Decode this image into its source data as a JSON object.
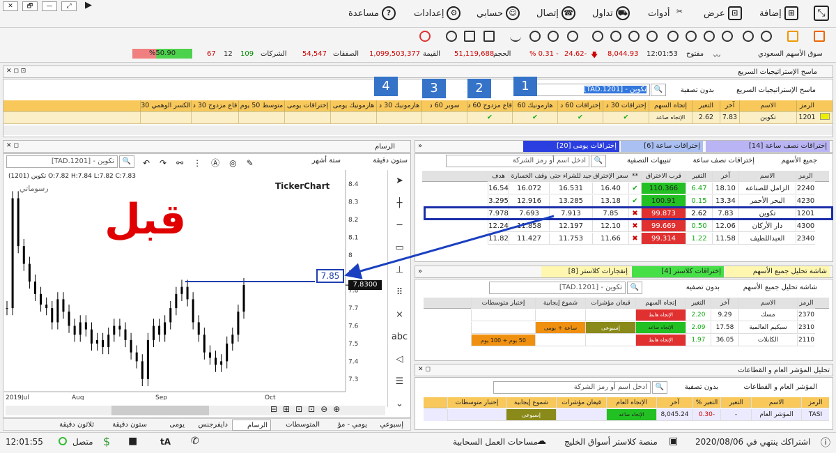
{
  "window": {
    "controls": [
      "✕",
      "🗗",
      "—",
      "⤢",
      "▶"
    ]
  },
  "menu": [
    {
      "label": "مساعدة",
      "icon": "?"
    },
    {
      "label": "إعدادات",
      "icon": "⚙"
    },
    {
      "label": "حسابي",
      "icon": "☺"
    },
    {
      "label": "إتصال",
      "icon": "☎"
    },
    {
      "label": "تداول",
      "icon": "⛟"
    },
    {
      "label": "أدوات",
      "icon": "✂"
    },
    {
      "label": "عرض",
      "icon": "⊡"
    },
    {
      "label": "إضافة",
      "icon": "⊞"
    }
  ],
  "ticker": {
    "market": "سوق الأسهم السعودي",
    "status": "مفتوح",
    "time": "12:01:53",
    "index": "8,044.93",
    "change": "24.62-",
    "change_pct": "% 0.31 -",
    "volume_label": "الحجم",
    "volume": "51,119,688",
    "value_label": "القيمة",
    "value": "1,099,503,377",
    "deals_label": "الصفقات",
    "deals": "54,547",
    "companies_label": "الشركات",
    "up": "109",
    "flat": "12",
    "down": "67",
    "ratio": "%50.90"
  },
  "strategy": {
    "title": "ماسح الإستراتيجيات السريع",
    "tab": "ماسح الإستراتيجيات السريع",
    "filter": "بدون تصفية",
    "search": "[TAD.1201] - تكوين",
    "columns": [
      "الرمز",
      "الاسم",
      "آخر",
      "التغير",
      "إتجاه السهم",
      "إختراقات 30 د",
      "إختراقات 60 د",
      "هارمونيك 60",
      "قاع مزدوج 60 د",
      "سوبر 60 د",
      "هارمونيك 30 د",
      "هارمونيك يومى",
      "إختراقات يومى",
      "متوسط 50 يوم",
      "قاع مزدوج 30 د",
      "الكسر الوهمي 30"
    ],
    "row": {
      "symbol": "1201",
      "name": "تكوين",
      "last": "7.83",
      "change": "2.62",
      "trend": "الإتجاه صاعد",
      "check": "✔"
    },
    "markers": [
      "1",
      "2",
      "3",
      "4"
    ]
  },
  "chart": {
    "panel_title": "الرسام",
    "search": "[TAD.1201] - تكوين",
    "interval": "ستون دقيقة",
    "range": "ستة أشهر",
    "ohlc": "(1201) تكوين O:7.82 H:7.84 L:7.82 C:7.83",
    "watermark": "رسوماتي",
    "brand": "TickerChart",
    "before": "قبل",
    "price_box": "7.85",
    "last_price": "7.8300",
    "xlabels": [
      "2019Jul",
      "Aug",
      "Sep",
      "Oct"
    ],
    "tabs": [
      "إسبوعي",
      "يومي - مؤ",
      "المتوسطات",
      "الرسام",
      "دايفرجنس",
      "يومى",
      "ستون دقيقة",
      "ثلاثون دقيقة"
    ]
  },
  "chart_data": {
    "type": "candlestick",
    "title": "",
    "xlabel": "",
    "ylabel": "",
    "x": [
      "2019Jul",
      "Aug",
      "Sep",
      "Oct"
    ],
    "y_ticks": [
      8.4,
      8.3,
      8.2,
      8.1,
      8.0,
      7.9,
      7.8,
      7.7,
      7.6,
      7.5,
      7.4,
      7.3
    ],
    "ylim": [
      7.26,
      8.44
    ],
    "last": 7.83,
    "annotation": 7.85,
    "series": [
      {
        "values": [
          7.7,
          8.32,
          8.05,
          7.95,
          7.85,
          7.78,
          7.72,
          7.7,
          7.62,
          7.75,
          7.68,
          7.6,
          7.55,
          7.62,
          7.58,
          7.5,
          7.52,
          7.48,
          7.55,
          7.6,
          7.58,
          7.52,
          7.45,
          7.4,
          7.3,
          7.52,
          7.6,
          7.55,
          7.62,
          7.7,
          7.78,
          7.82,
          7.75,
          7.62,
          7.55,
          7.45,
          7.42,
          7.38,
          7.4,
          7.5,
          7.55,
          7.68,
          7.83
        ]
      }
    ]
  },
  "scans": {
    "tabs": [
      "إختراقات نصف ساعة [14]",
      "إختراقات ساعة [6]",
      "إختراقات يومى [20]"
    ],
    "all": "جميع الأسهم",
    "sub": "إختراقات نصف ساعة",
    "alerts": "تنبيهات التصفية",
    "search": "ادخل اسم أو رمز الشركة",
    "columns": [
      "الرمز",
      "الاسم",
      "آخر",
      "التغير",
      "قرب الاختراق",
      "**",
      "سعر الإختراق",
      "جيد للشراء حتى",
      "وقف الخسارة",
      "هدف"
    ],
    "rows": [
      [
        "2240",
        "الزامل للصناعة",
        "18.10",
        "6.47",
        "110.366",
        "✔",
        "16.40",
        "16.531",
        "16.072",
        "16.54"
      ],
      [
        "4230",
        "البحر الأحمر",
        "13.34",
        "0.15",
        "100.91",
        "✔",
        "13.18",
        "13.285",
        "12.916",
        "3.295"
      ],
      [
        "1201",
        "تكوين",
        "7.83",
        "2.62",
        "99.873",
        "✖",
        "7.85",
        "7.913",
        "7.693",
        "7.978"
      ],
      [
        "4300",
        "دار الأركان",
        "12.06",
        "0.50",
        "99.669",
        "✖",
        "12.10",
        "12.197",
        "11.858",
        "12.24"
      ],
      [
        "2340",
        "العبداللطيف",
        "11.58",
        "1.22",
        "99.314",
        "✖",
        "11.66",
        "11.753",
        "11.427",
        "11.82"
      ]
    ]
  },
  "analysis": {
    "tabs": [
      "شاشة تحليل جميع الأسهم",
      "إختراقات كلاستر [4]",
      "إنفجارات كلاستر [8]"
    ],
    "tab": "شاشة تحليل جميع الأسهم",
    "filter": "بدون تصفية",
    "search": "[TAD.1201] - تكوين",
    "columns": [
      "الرمز",
      "الاسم",
      "آخر",
      "التغير",
      "إتجاه السهم",
      "قيعان مؤشرات",
      "شموع إيجابية",
      "إختبار متوسطات"
    ],
    "rows": [
      [
        "2370",
        "مسك",
        "9.29",
        "2.20",
        "الإتجاه هابط",
        "",
        "",
        ""
      ],
      [
        "2310",
        "سبكيم العالمية",
        "17.58",
        "2.09",
        "الإتجاه صاعد",
        "إسبوعى",
        "ساعة + يومى",
        ""
      ],
      [
        "2110",
        "الكابلات",
        "36.05",
        "1.97",
        "الإتجاه هابط",
        "",
        "",
        "50 يوم + 100 يوم"
      ]
    ]
  },
  "index": {
    "title": "تحليل المؤشر العام و القطاعات",
    "tab": "المؤشر العام و القطاعات",
    "filter": "بدون تصفية",
    "search": "ادخل اسم أو رمز الشركة",
    "columns": [
      "الرمز",
      "الاسم",
      "التغير",
      "التغير %",
      "آخر",
      "الإتجاه العام",
      "قيعان مؤشرات",
      "شموع إيجابية",
      "إختبار متوسطات"
    ],
    "row": [
      "TASI",
      "المؤشر العام",
      "-",
      "-0.30",
      "8,045.24",
      "الإتجاه صاعد",
      "",
      "إسبوعى",
      ""
    ]
  },
  "status": {
    "subscription": "اشتراكك ينتهي في 2020/08/06",
    "cluster": "منصة كلاستر أسواق الخليج",
    "cloud": "مساحات العمل السحابية",
    "connected": "متصل",
    "clock": "12:01:55"
  }
}
